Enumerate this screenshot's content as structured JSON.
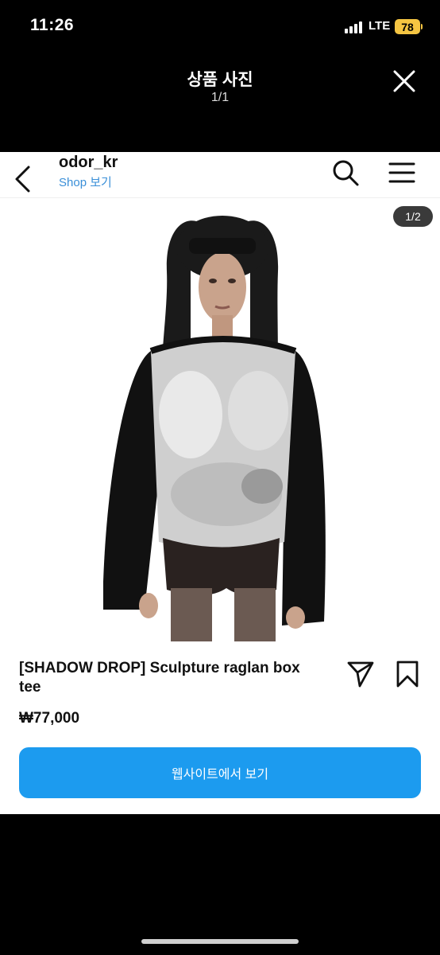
{
  "status_bar": {
    "time": "11:26",
    "network": "LTE",
    "battery": "78"
  },
  "header": {
    "title": "상품 사진",
    "page_indicator": "1/1"
  },
  "profile": {
    "username": "odor_kr",
    "shop_link": "Shop 보기"
  },
  "image": {
    "counter": "1/2"
  },
  "product": {
    "name": "[SHADOW DROP] Sculpture raglan box tee",
    "price": "₩77,000",
    "cta_label": "웹사이트에서 보기"
  },
  "colors": {
    "accent": "#1c9bef",
    "link": "#3a8fd8",
    "battery": "#f5c542"
  },
  "icons": [
    "signal-icon",
    "battery-icon",
    "close-icon",
    "back-icon",
    "search-icon",
    "menu-icon",
    "share-icon",
    "bookmark-icon"
  ]
}
